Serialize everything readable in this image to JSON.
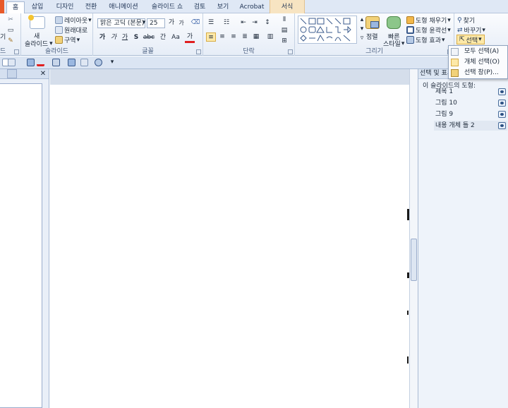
{
  "tabs": [
    {
      "label": "홈",
      "active": true
    },
    {
      "label": "삽입"
    },
    {
      "label": "디자인"
    },
    {
      "label": "전환"
    },
    {
      "label": "애니메이션"
    },
    {
      "label": "슬라이드 쇼"
    },
    {
      "label": "검토"
    },
    {
      "label": "보기"
    },
    {
      "label": "Acrobat"
    },
    {
      "label": "서식",
      "contextual": true
    }
  ],
  "ribbon": {
    "clipboard": {
      "label_partial": "드",
      "paste_partial": "기"
    },
    "slides": {
      "new_slide_line1": "새",
      "new_slide_line2": "슬라이드",
      "layout": "레이아웃",
      "reset": "원래대로",
      "section": "구역",
      "group_label": "슬라이드"
    },
    "font": {
      "font_name": "맑은 고딕 (본문)",
      "font_size": "25",
      "grow": "가",
      "shrink": "가",
      "bold": "가",
      "italic": "가",
      "underline": "가",
      "strike": "S",
      "shadow": "abc",
      "spacing": "간",
      "case": "Aa",
      "color": "가",
      "group_label": "글꼴"
    },
    "paragraph": {
      "group_label": "단락"
    },
    "drawing": {
      "arrange": "정렬",
      "quick_styles_line1": "빠른",
      "quick_styles_line2": "스타일",
      "shape_fill": "도형 채우기",
      "shape_outline": "도형 윤곽선",
      "shape_effects": "도형 효과",
      "group_label": "그리기"
    },
    "editing": {
      "find": "찾기",
      "replace": "바꾸기",
      "select": "선택"
    }
  },
  "select_menu": {
    "items": [
      {
        "label": "모두 선택(A)"
      },
      {
        "label": "개체 선택(O)"
      },
      {
        "label": "선택 창(P)..."
      }
    ]
  },
  "selection_pane": {
    "title": "선택 및 표시",
    "subhead": "이 슬라이드의 도형:",
    "shapes": [
      {
        "label": "제목 1"
      },
      {
        "label": "그림 10"
      },
      {
        "label": "그림 9"
      },
      {
        "label": "내용 개체 틀 2",
        "highlighted": true
      }
    ]
  },
  "colors": {
    "file_tab": "#e85a2a",
    "context_tab": "#f7e4c2",
    "ribbon_bg": "#e6edf7",
    "font_color_underline": "#e02020",
    "selected_button": "#fde9a8"
  }
}
